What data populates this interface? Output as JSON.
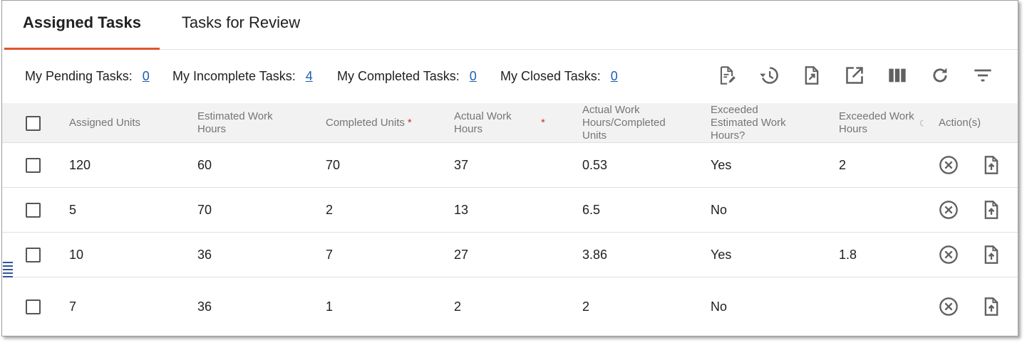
{
  "tabs": [
    {
      "label": "Assigned Tasks",
      "active": true
    },
    {
      "label": "Tasks for Review",
      "active": false
    }
  ],
  "summary": {
    "pending_label": "My Pending Tasks:",
    "pending_count": "0",
    "incomplete_label": "My Incomplete Tasks:",
    "incomplete_count": "4",
    "completed_label": "My Completed Tasks:",
    "completed_count": "0",
    "closed_label": "My Closed Tasks:",
    "closed_count": "0"
  },
  "toolbar": {
    "icons": [
      "edit-document-icon",
      "history-icon",
      "export-icon",
      "open-external-icon",
      "columns-icon",
      "refresh-icon",
      "filter-icon"
    ]
  },
  "table": {
    "headers": {
      "assigned_units": "Assigned Units",
      "estimated_line1": "Estimated Work",
      "estimated_line2": "Hours",
      "completed_units": "Completed Units",
      "actual_line1": "Actual Work",
      "actual_line2": "Hours",
      "ratio_line1": "Actual Work",
      "ratio_line2": "Hours/Completed",
      "ratio_line3": "Units",
      "exceeded_line1": "Exceeded",
      "exceeded_line2": "Estimated Work",
      "exceeded_line3": "Hours?",
      "exceeded_hours_line1": "Exceeded Work",
      "exceeded_hours_line2": "Hours",
      "actions": "Action(s)",
      "required_mark": "*"
    },
    "rows": [
      {
        "assigned": "120",
        "estimated": "60",
        "completed": "70",
        "actual": "37",
        "ratio": "0.53",
        "exceeded": "Yes",
        "exceeded_hours": "2"
      },
      {
        "assigned": "5",
        "estimated": "70",
        "completed": "2",
        "actual": "13",
        "ratio": "6.5",
        "exceeded": "No",
        "exceeded_hours": ""
      },
      {
        "assigned": "10",
        "estimated": "36",
        "completed": "7",
        "actual": "27",
        "ratio": "3.86",
        "exceeded": "Yes",
        "exceeded_hours": "1.8"
      },
      {
        "assigned": "7",
        "estimated": "36",
        "completed": "1",
        "actual": "2",
        "ratio": "2",
        "exceeded": "No",
        "exceeded_hours": ""
      }
    ]
  },
  "colors": {
    "accent": "#e0542a",
    "link": "#1a5fb4",
    "required": "#d32f2f",
    "header_bg": "#f2f2f2"
  }
}
